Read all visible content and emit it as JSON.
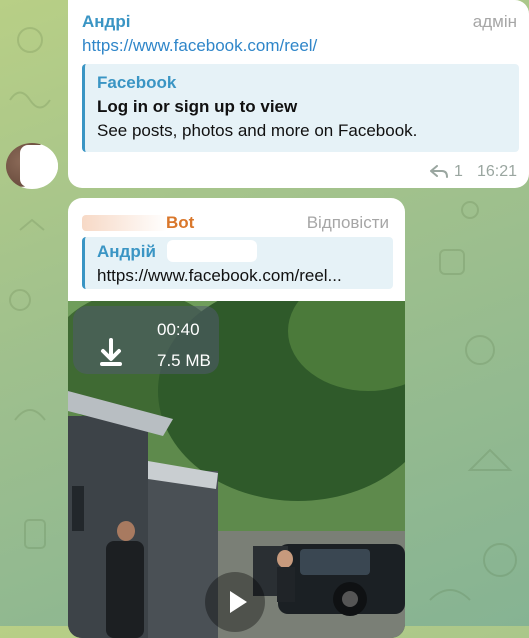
{
  "message1": {
    "sender": "Андрі",
    "role": "адмін",
    "link": "https://www.facebook.com/reel/",
    "preview": {
      "site": "Facebook",
      "title": "Log in or sign up to view",
      "description": "See posts, photos and more on Facebook."
    },
    "reply_count": "1",
    "time": "16:21"
  },
  "message2": {
    "sender": "Bot",
    "reply_action": "Відповісти",
    "quote": {
      "name": "Андрій",
      "text": "https://www.facebook.com/reel..."
    },
    "video": {
      "duration": "00:40",
      "size": "7.5 MB"
    }
  },
  "icons": {
    "reply": "reply-arrow-icon",
    "download": "download-icon",
    "play": "play-icon"
  },
  "colors": {
    "link": "#2f86c9",
    "sender1": "#3a95c4",
    "sender2": "#d9772b",
    "background": "#a9c78b"
  }
}
